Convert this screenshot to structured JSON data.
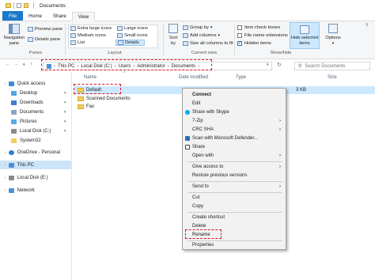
{
  "window": {
    "title": "Documents"
  },
  "tabs": {
    "file": "File",
    "home": "Home",
    "share": "Share",
    "view": "View"
  },
  "ribbon": {
    "nav_pane": "Navigation\npane",
    "nav_pane_l1": "Navigation",
    "nav_pane_l2": "pane",
    "preview_pane": "Preview pane",
    "details_pane": "Details pane",
    "panes_label": "Panes",
    "layout": {
      "extra_large": "Extra large icons",
      "large": "Large icons",
      "medium": "Medium icons",
      "small": "Small icons",
      "list": "List",
      "details": "Details",
      "label": "Layout"
    },
    "sort_by_l1": "Sort",
    "sort_by_l2": "by",
    "group_by": "Group by",
    "add_columns": "Add columns",
    "size_all_columns": "Size all columns to fit",
    "current_view_label": "Current view",
    "item_check_boxes": "Item check boxes",
    "file_name_extensions": "File name extensions",
    "hidden_items": "Hidden items",
    "hide_selected_l1": "Hide selected",
    "hide_selected_l2": "items",
    "options": "Options",
    "show_hide_label": "Show/hide"
  },
  "address": {
    "crumbs": [
      "This PC",
      "Local Disk (C:)",
      "Users",
      "Administrator",
      "Documents"
    ],
    "search_placeholder": "Search Documents"
  },
  "nav": {
    "items": [
      {
        "label": "Quick access",
        "icon": "star-icon",
        "color": "#3b8ad8"
      },
      {
        "label": "Desktop",
        "icon": "desktop-icon",
        "color": "#4ea6e8",
        "pinned": true
      },
      {
        "label": "Downloads",
        "icon": "download-icon",
        "color": "#3b7fd0",
        "pinned": true
      },
      {
        "label": "Documents",
        "icon": "documents-icon",
        "color": "#8aa5c4",
        "pinned": true
      },
      {
        "label": "Pictures",
        "icon": "pictures-icon",
        "color": "#59a9e3",
        "pinned": true
      },
      {
        "label": "Local Disk (C:)",
        "icon": "drive-icon",
        "color": "#8a8a8a",
        "pinned": true
      },
      {
        "label": "System32",
        "icon": "folder-icon",
        "color": "#f3cf5a"
      },
      {
        "label": "OneDrive - Personal",
        "icon": "cloud-icon",
        "color": "#2f7fd6"
      },
      {
        "label": "This PC",
        "icon": "pc-icon",
        "color": "#4a90d9"
      },
      {
        "label": "Local Disk (E:)",
        "icon": "drive-icon",
        "color": "#8a8a8a"
      },
      {
        "label": "Network",
        "icon": "network-icon",
        "color": "#4a90d9"
      }
    ]
  },
  "columns": {
    "name": "Name",
    "date_modified": "Date modified",
    "type": "Type",
    "size": "Size"
  },
  "files": [
    {
      "name": "Default",
      "date": "",
      "size": "3 KB"
    },
    {
      "name": "Scanned Documents",
      "date": ""
    },
    {
      "name": "Fax",
      "date": ""
    }
  ],
  "context_menu": {
    "items": [
      {
        "label": "Connect",
        "bold": true
      },
      {
        "label": "Edit"
      },
      {
        "label": "Share with Skype",
        "icon": "skype-icon"
      },
      {
        "label": "7-Zip",
        "submenu": true
      },
      {
        "label": "CRC SHA",
        "submenu": true
      },
      {
        "label": "Scan with Microsoft Defender...",
        "icon": "defender-icon"
      },
      {
        "label": "Share",
        "icon": "share-icon"
      },
      {
        "label": "Open with",
        "submenu": true
      },
      {
        "label": "Give access to",
        "submenu": true
      },
      {
        "label": "Restore previous versions"
      },
      {
        "label": "Send to",
        "submenu": true
      },
      {
        "label": "Cut"
      },
      {
        "label": "Copy"
      },
      {
        "label": "Create shortcut"
      },
      {
        "label": "Delete"
      },
      {
        "label": "Rename"
      },
      {
        "label": "Properties"
      }
    ]
  },
  "colors": {
    "accent": "#1979ca",
    "highlight": "#e0141e",
    "selection": "#cce8ff"
  }
}
